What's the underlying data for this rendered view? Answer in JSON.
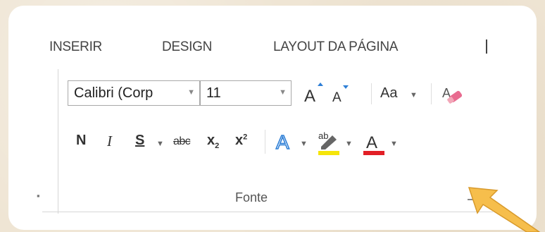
{
  "tabs": [
    "INSERIR",
    "DESIGN",
    "LAYOUT DA PÁGINA"
  ],
  "font": {
    "name": "Calibri (Corp",
    "size": "11",
    "case_label": "Aa",
    "bold": "N",
    "italic": "I",
    "underline": "S",
    "strikethrough": "abc",
    "subscript_base": "x",
    "subscript_mark": "2",
    "superscript_base": "x",
    "superscript_mark": "2",
    "text_effects": "A",
    "highlight": "ab",
    "font_color": "A",
    "group_label": "Fonte"
  },
  "colors": {
    "highlight_bar": "#f5e50a",
    "font_color_bar": "#e21f26",
    "text_effect_blue": "#2e7fd6",
    "arrow": "#f6be4c"
  },
  "icons": [
    "grow-font-icon",
    "shrink-font-icon",
    "clear-formatting-icon",
    "dialog-launcher-icon",
    "pointer-arrow-icon"
  ]
}
